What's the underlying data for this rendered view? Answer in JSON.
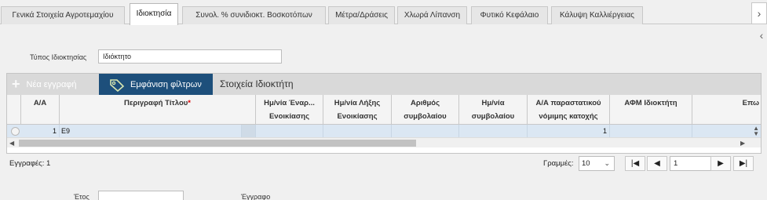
{
  "tabs": [
    {
      "label": "Γενικά Στοιχεία Αγροτεμαχίου"
    },
    {
      "label": "Ιδιοκτησία"
    },
    {
      "label": "Συνολ. % συνιδιοκτ. Βοσκοτόπων"
    },
    {
      "label": "Μέτρα/Δράσεις"
    },
    {
      "label": "Χλωρά Λίπανση"
    },
    {
      "label": "Φυτικό Κεφάλαιο"
    },
    {
      "label": "Κάλυψη Καλλιέργειας"
    }
  ],
  "ownership_type": {
    "label": "Τύπος Ιδιοκτησίας",
    "value": "Ιδιόκτητο"
  },
  "toolbar": {
    "new_record": "Νέα εγγραφή",
    "show_filters": "Εμφάνιση φίλτρων",
    "owner_details": "Στοιχεία Ιδιοκτήτη"
  },
  "columns": {
    "aa": "Α/Α",
    "title_desc": "Περιγραφή Τίτλου",
    "lease_start": "Ημ/νία Έναρ... Ενοικίασης",
    "lease_end": "Ημ/νία Λήξης Ενοικίασης",
    "contract_no": "Αριθμός συμβολαίου",
    "contract_date": "Ημ/νία συμβολαίου",
    "legal_doc_aa": "Α/Α παραστατικού νόμιμης κατοχής",
    "owner_afm": "ΑΦΜ Ιδιοκτήτη",
    "surname": "Επω"
  },
  "rows": [
    {
      "aa": "1",
      "title_desc": "Ε9",
      "lease_start": "",
      "lease_end": "",
      "contract_no": "",
      "contract_date": "",
      "legal_doc_aa": "1",
      "owner_afm": "",
      "surname": ""
    }
  ],
  "footer": {
    "records_label": "Εγγραφές: 1",
    "rows_label": "Γραμμές:",
    "rows_value": "10",
    "page_value": "1"
  },
  "bottom": {
    "year_label": "Έτος",
    "document_label": "Έγγραφο"
  },
  "colors": {
    "accent": "#1d4f7b",
    "selected_row": "#dbe7f3",
    "required": "#dd0000"
  }
}
